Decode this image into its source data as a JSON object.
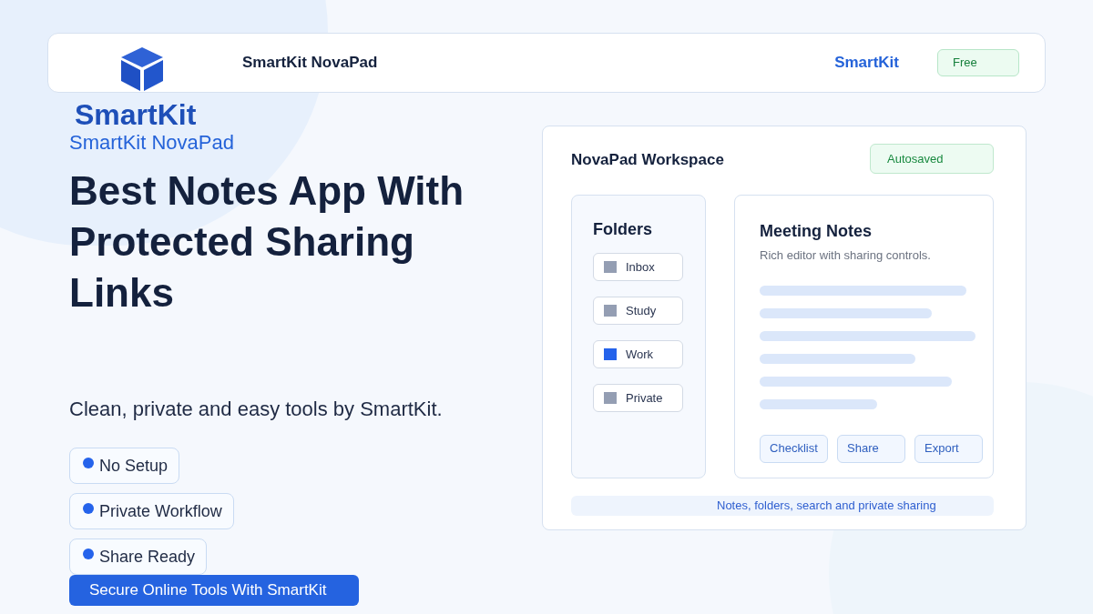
{
  "header": {
    "title": "SmartKit NovaPad",
    "brand_link": "SmartKit",
    "badge": "Free"
  },
  "hero": {
    "wordmark": "SmartKit",
    "product": "SmartKit NovaPad",
    "heading": "Best Notes App With Protected Sharing Links",
    "tagline": "Clean, private and easy tools by SmartKit.",
    "features": [
      "No Setup",
      "Private Workflow",
      "Share Ready"
    ],
    "cta": "Secure Online Tools With SmartKit"
  },
  "workspace": {
    "title": "NovaPad Workspace",
    "status": "Autosaved",
    "folders_title": "Folders",
    "folders": [
      {
        "label": "Inbox",
        "selected": false
      },
      {
        "label": "Study",
        "selected": false
      },
      {
        "label": "Work",
        "selected": true
      },
      {
        "label": "Private",
        "selected": false
      }
    ],
    "note": {
      "title": "Meeting Notes",
      "subtitle": "Rich editor with sharing controls.",
      "actions": [
        "Checklist",
        "Share",
        "Export"
      ]
    },
    "footer": "Notes, folders, search and private sharing"
  }
}
